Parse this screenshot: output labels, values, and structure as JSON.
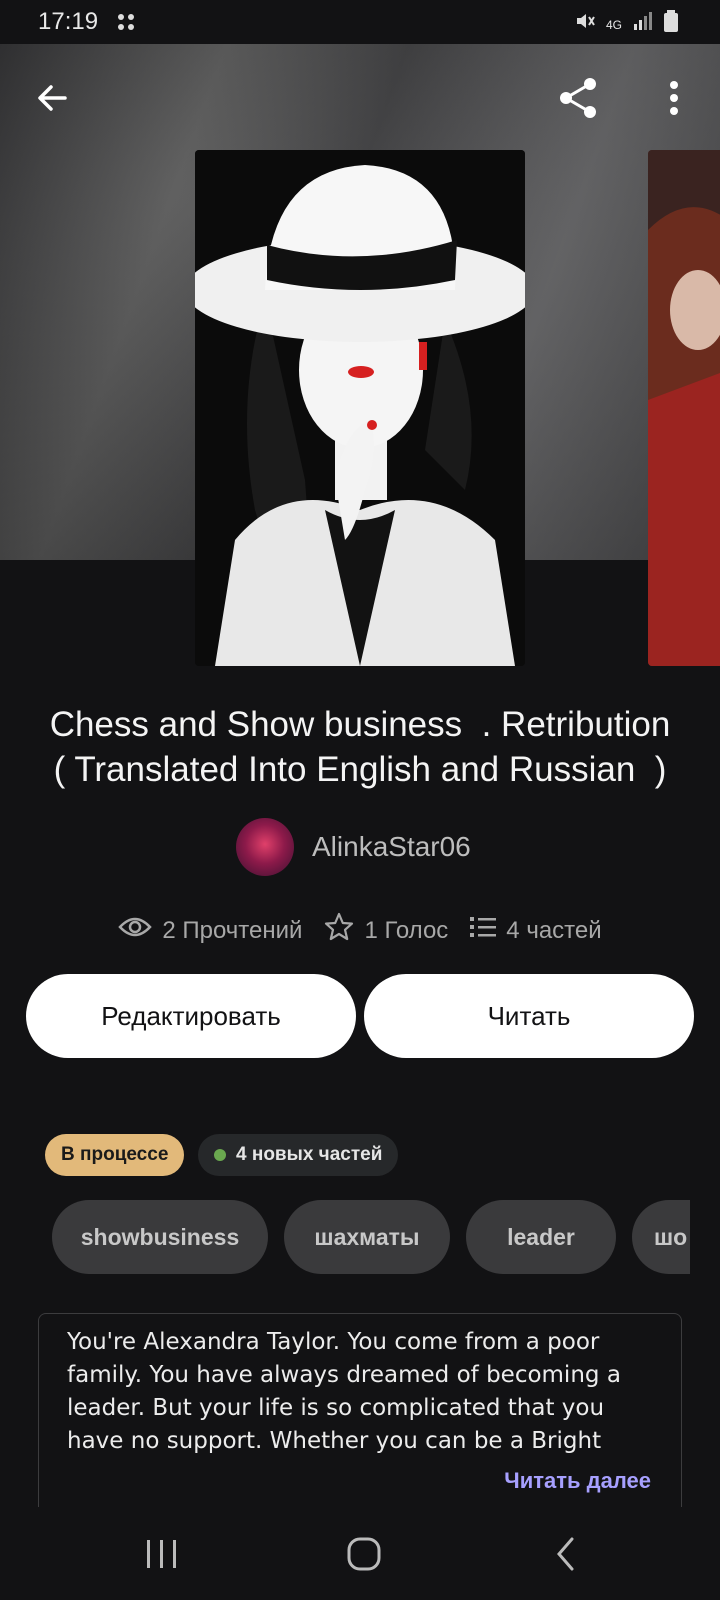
{
  "status_bar": {
    "time": "17:19",
    "network": "4G"
  },
  "toolbar": {
    "back_icon": "arrow-left-icon",
    "share_icon": "share-icon",
    "menu_icon": "more-vertical-icon"
  },
  "story": {
    "title_line1": "Chess and Show business  . Retribution",
    "title_line2": "( Translated Into English and Russian  )",
    "author": "AlinkaStar06",
    "stats": {
      "reads": "2 Прочтений",
      "votes": "1 Голос",
      "parts": "4 частей"
    },
    "status_badge": "В процессе",
    "new_parts_badge": "4 новых частей",
    "tags": [
      "showbusiness",
      "шахматы",
      "leader",
      "шо"
    ],
    "description": "You're Alexandra Taylor. You come from a poor family. You have always dreamed of becoming a leader. But your life is so complicated that you have no support. Whether you can be a Bright Person in life , it all",
    "read_more": "Читать далее"
  },
  "actions": {
    "edit_label": "Редактировать",
    "read_label": "Читать"
  },
  "colors": {
    "background": "#121214",
    "button_bg": "#ffffff",
    "status_badge_bg": "#e2b97a",
    "new_parts_dot": "#6aa84f",
    "read_more": "#a7a0ff",
    "tag_bg": "#3a3a3c"
  }
}
